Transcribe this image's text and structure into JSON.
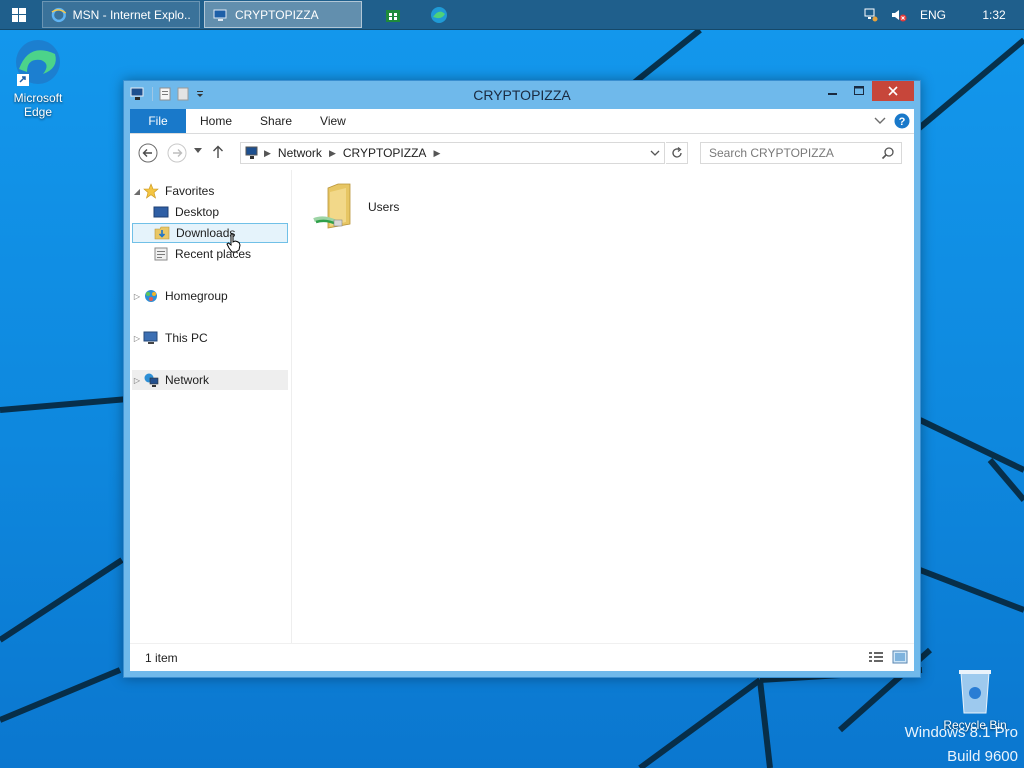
{
  "taskbar": {
    "items": [
      {
        "label": "MSN - Internet Explo...",
        "icon": "ie-icon"
      },
      {
        "label": "CRYPTOPIZZA",
        "icon": "network-folder-icon"
      }
    ],
    "pinned": [
      "store-icon",
      "edge-icon"
    ],
    "tray": {
      "lang": "ENG",
      "clock": "1:32"
    }
  },
  "desktop": {
    "edge_label_1": "Microsoft",
    "edge_label_2": "Edge",
    "recycle_bin_label": "Recycle Bin",
    "watermark_line1": "Windows 8.1 Pro",
    "watermark_line2": "Build 9600"
  },
  "window": {
    "title": "CRYPTOPIZZA",
    "ribbon_tabs": [
      "File",
      "Home",
      "Share",
      "View"
    ],
    "address": {
      "segments": [
        "Network",
        "CRYPTOPIZZA"
      ]
    },
    "search": {
      "placeholder": "Search CRYPTOPIZZA"
    },
    "nav": {
      "favorites": "Favorites",
      "desktop": "Desktop",
      "downloads": "Downloads",
      "recent": "Recent places",
      "homegroup": "Homegroup",
      "thispc": "This PC",
      "network": "Network"
    },
    "items": [
      {
        "name": "Users"
      }
    ],
    "status": "1 item"
  },
  "colors": {
    "accent": "#1979ca",
    "close": "#c7463a",
    "titlebar": "#6fb9eb"
  }
}
